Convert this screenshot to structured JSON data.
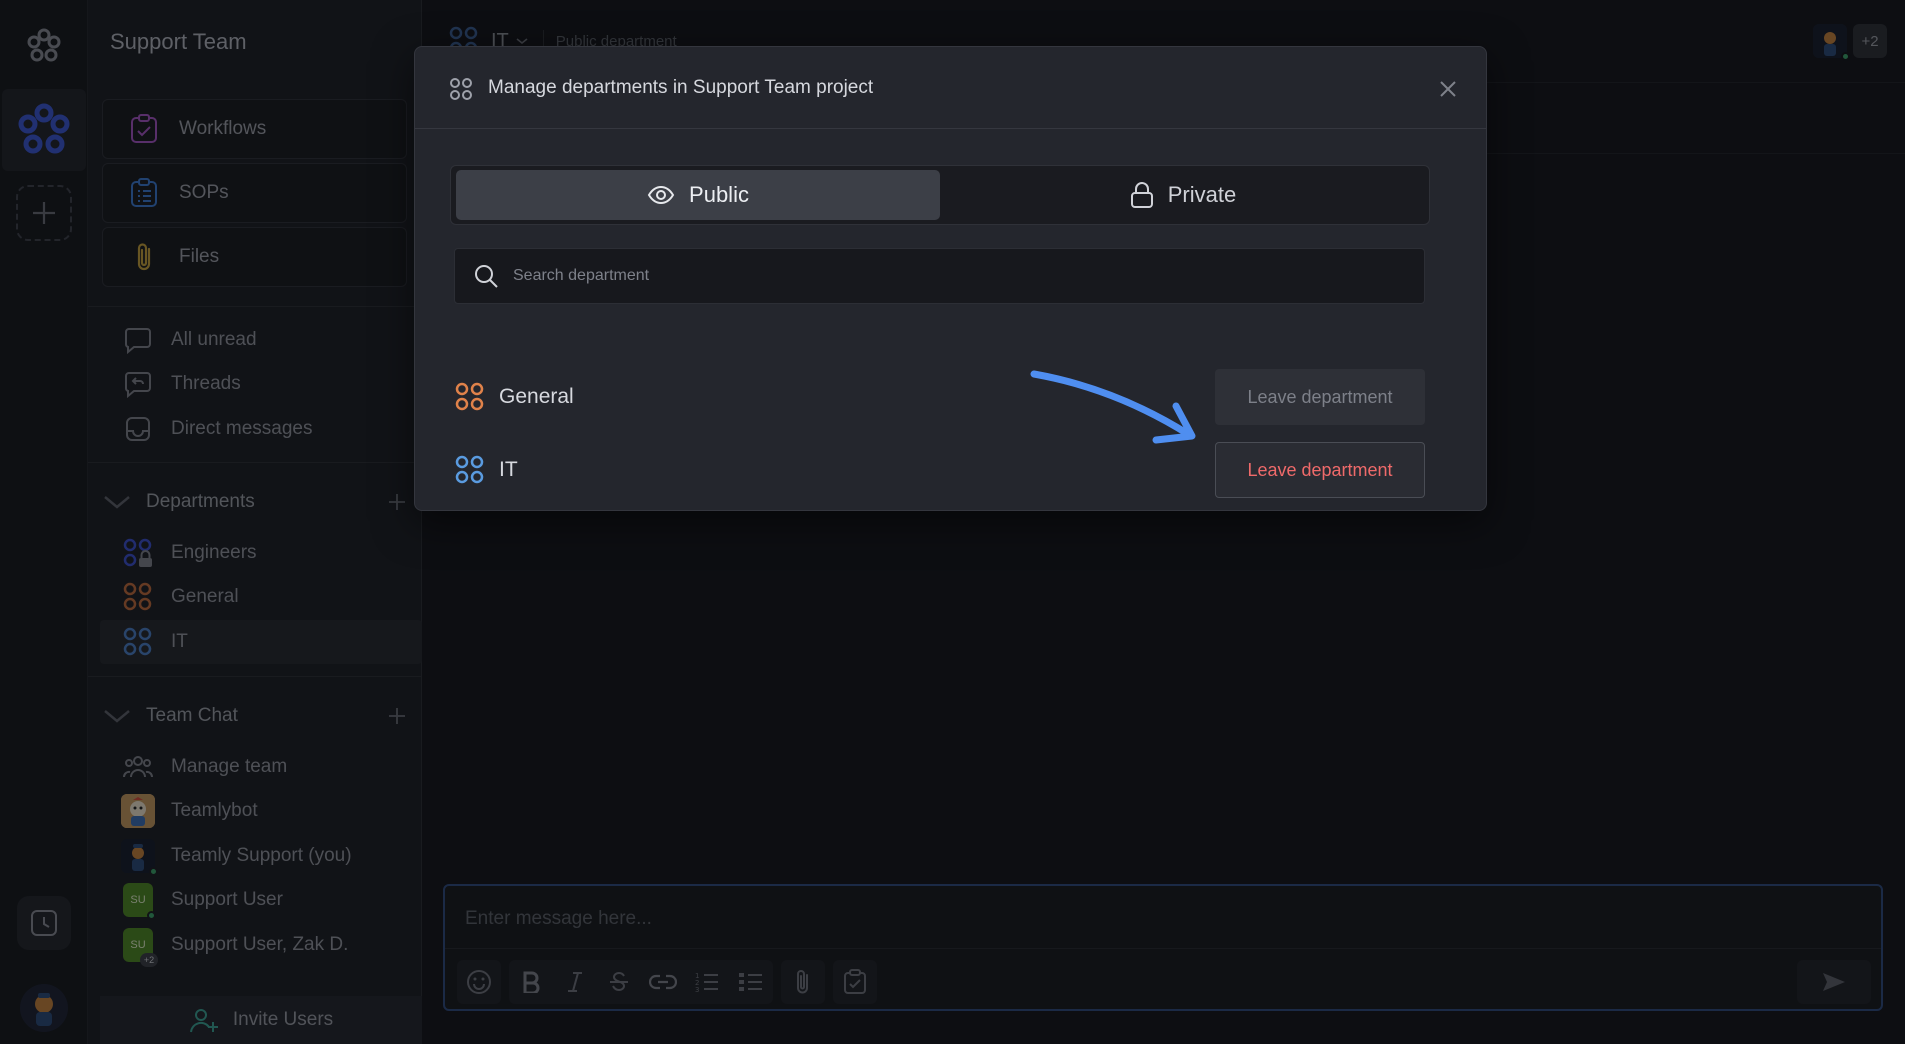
{
  "sidebar": {
    "team_title": "Support Team",
    "quick_links": [
      {
        "label": "Workflows",
        "icon": "clipboard-check-icon",
        "color": "#a855c9"
      },
      {
        "label": "SOPs",
        "icon": "clipboard-list-icon",
        "color": "#3a7bd5"
      },
      {
        "label": "Files",
        "icon": "paperclip-icon",
        "color": "#c9a23a"
      }
    ],
    "nav": [
      {
        "label": "All unread",
        "icon": "chat-bubble-icon"
      },
      {
        "label": "Threads",
        "icon": "thread-icon"
      },
      {
        "label": "Direct messages",
        "icon": "inbox-icon"
      }
    ],
    "departments_header": "Departments",
    "departments": [
      {
        "label": "Engineers",
        "color": "#3b4fd1",
        "locked": true
      },
      {
        "label": "General",
        "color": "#c26a3a"
      },
      {
        "label": "IT",
        "color": "#4a7fc9",
        "active": true
      }
    ],
    "team_chat_header": "Team Chat",
    "team_chat": [
      {
        "label": "Manage team",
        "icon": "team-icon"
      },
      {
        "label": "Teamlybot",
        "icon": "bot-avatar"
      },
      {
        "label": "Teamly Support (you)",
        "icon": "user-avatar"
      },
      {
        "label": "Support User",
        "initials": "SU",
        "color": "#4f8a22"
      },
      {
        "label": "Support User, Zak D.",
        "initials": "SU",
        "color": "#4f8a22",
        "badge": "+2"
      }
    ],
    "invite_label": "Invite Users"
  },
  "main": {
    "channel_name": "IT",
    "channel_desc": "Public department",
    "extra_users": "+2",
    "composer_placeholder": "Enter message here..."
  },
  "modal": {
    "title": "Manage departments in Support Team project",
    "tabs": {
      "public": "Public",
      "private": "Private"
    },
    "search_placeholder": "Search department",
    "departments": [
      {
        "name": "General",
        "color": "#e0824a",
        "button": "Leave department",
        "state": "disabled"
      },
      {
        "name": "IT",
        "color": "#5a9be0",
        "button": "Leave department",
        "state": "danger"
      }
    ]
  },
  "colors": {
    "accent": "#3b6fe0",
    "danger": "#ef6a6a",
    "annotation_arrow": "#4f8ef0"
  }
}
